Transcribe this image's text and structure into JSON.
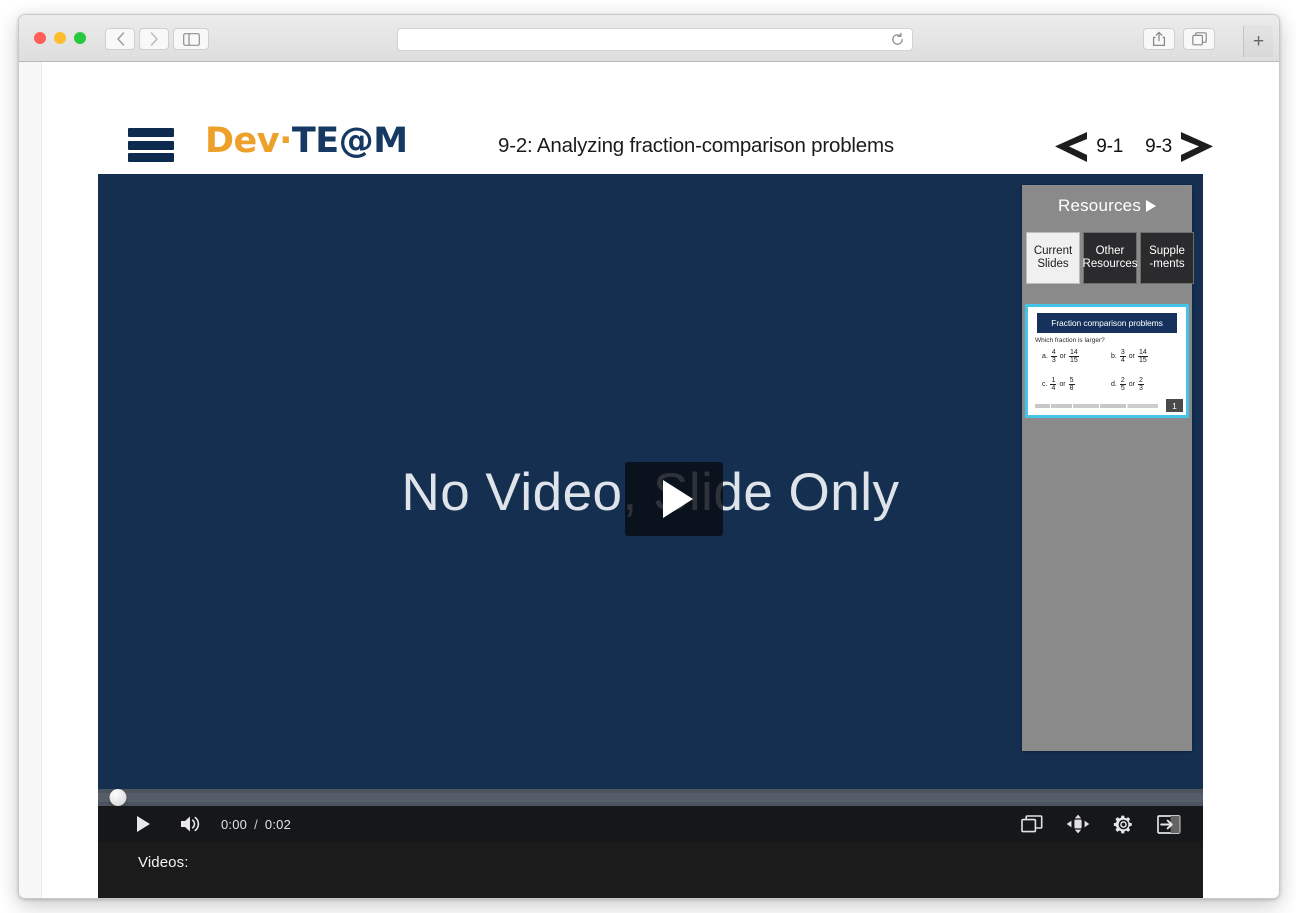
{
  "browser": {
    "traffic_lights": [
      "close",
      "minimize",
      "maximize"
    ],
    "back_label": "‹",
    "forward_label": "›",
    "address_value": "",
    "address_placeholder": "",
    "newtab_label": "+"
  },
  "header": {
    "menu_icon": "hamburger-icon",
    "logo": {
      "part1": "Dev",
      "dot": "·",
      "part2": "TE",
      "at": "@",
      "part3": "M",
      "color_orange": "#eda12a",
      "color_navy": "#153962"
    },
    "title": "9-2: Analyzing fraction-comparison problems",
    "prev_label": "9-1",
    "next_label": "9-3"
  },
  "stage": {
    "placeholder_text": "No Video, Slide Only",
    "background_color": "#152f50"
  },
  "resources": {
    "title": "Resources",
    "tabs": [
      {
        "line1": "Current",
        "line2": "Slides",
        "active": true
      },
      {
        "line1": "Other",
        "line2": "Resources",
        "active": false
      },
      {
        "line1": "Supple",
        "line2": "-ments",
        "active": false
      }
    ],
    "thumbnail": {
      "slide_title": "Fraction comparison problems",
      "prompt": "Which fraction is larger?",
      "page_number": "1",
      "items": [
        {
          "label": "a.",
          "left_num": "4",
          "left_den": "3",
          "conj": "or",
          "right_num": "14",
          "right_den": "15"
        },
        {
          "label": "b.",
          "left_num": "3",
          "left_den": "4",
          "conj": "or",
          "right_num": "14",
          "right_den": "15"
        },
        {
          "label": "c.",
          "left_num": "1",
          "left_den": "4",
          "conj": "or",
          "right_num": "5",
          "right_den": "8"
        },
        {
          "label": "d.",
          "left_num": "2",
          "left_den": "5",
          "conj": "or",
          "right_num": "2",
          "right_den": "3"
        }
      ]
    }
  },
  "player": {
    "play_icon": "play-icon",
    "volume_icon": "volume-icon",
    "current_time": "0:00",
    "separator": "/",
    "duration": "0:02",
    "right_icons": [
      "picture-in-picture-icon",
      "pan-move-icon",
      "settings-gear-icon",
      "fullscreen-exit-icon"
    ]
  },
  "notes": {
    "label": "Videos:"
  }
}
